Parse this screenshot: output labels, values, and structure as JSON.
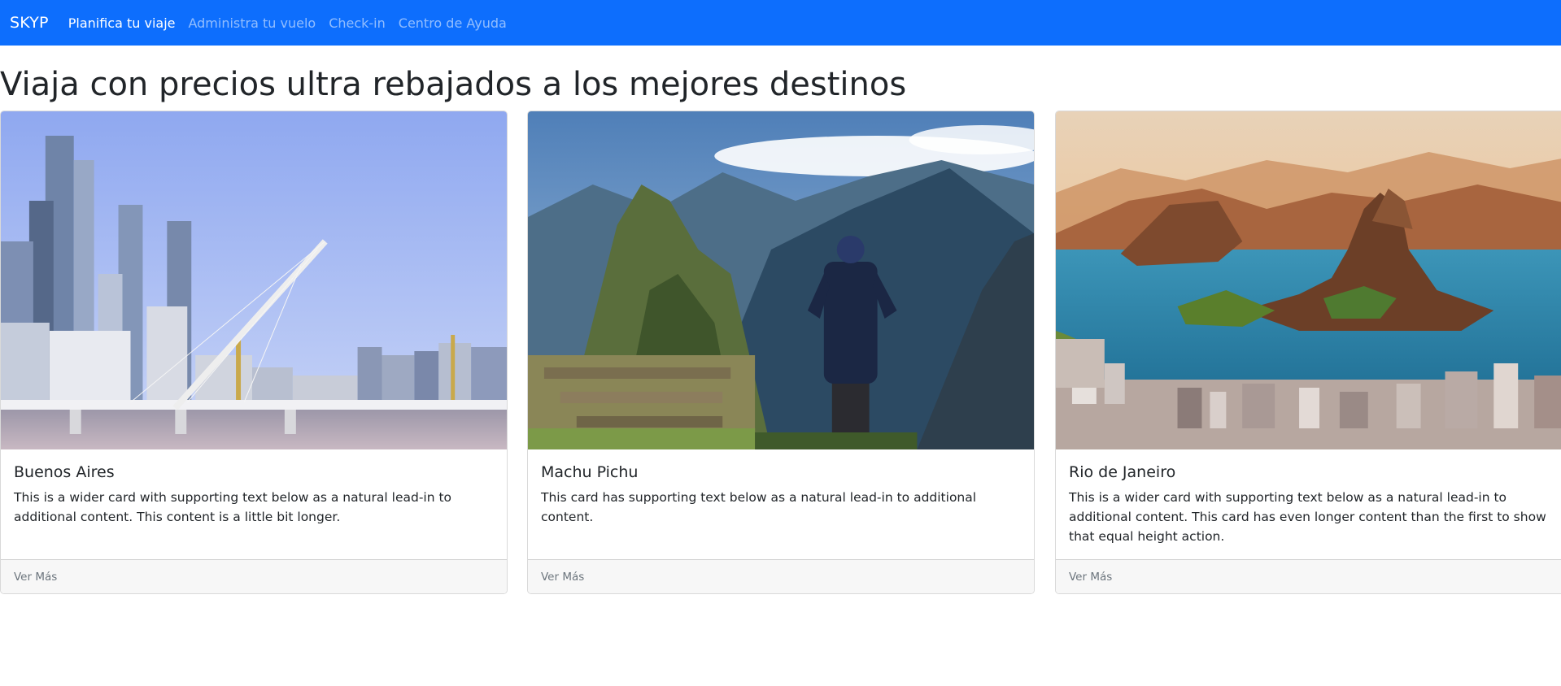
{
  "navbar": {
    "brand": "SKYP",
    "links": [
      {
        "label": "Planifica tu viaje",
        "active": true
      },
      {
        "label": "Administra tu vuelo",
        "active": false
      },
      {
        "label": "Check-in",
        "active": false
      },
      {
        "label": "Centro de Ayuda",
        "active": false
      }
    ],
    "color": "#0d6efd"
  },
  "main": {
    "title": "Viaja con precios ultra rebajados a los mejores destinos"
  },
  "cards": [
    {
      "title": "Buenos Aires",
      "text": "This is a wider card with supporting text below as a natural lead-in to additional content. This content is a little bit longer.",
      "footer": "Ver Más"
    },
    {
      "title": "Machu Pichu",
      "text": "This card has supporting text below as a natural lead-in to additional content.",
      "footer": "Ver Más"
    },
    {
      "title": "Rio de Janeiro",
      "text": "This is a wider card with supporting text below as a natural lead-in to additional content. This card has even longer content than the first to show that equal height action.",
      "footer": "Ver Más"
    }
  ]
}
